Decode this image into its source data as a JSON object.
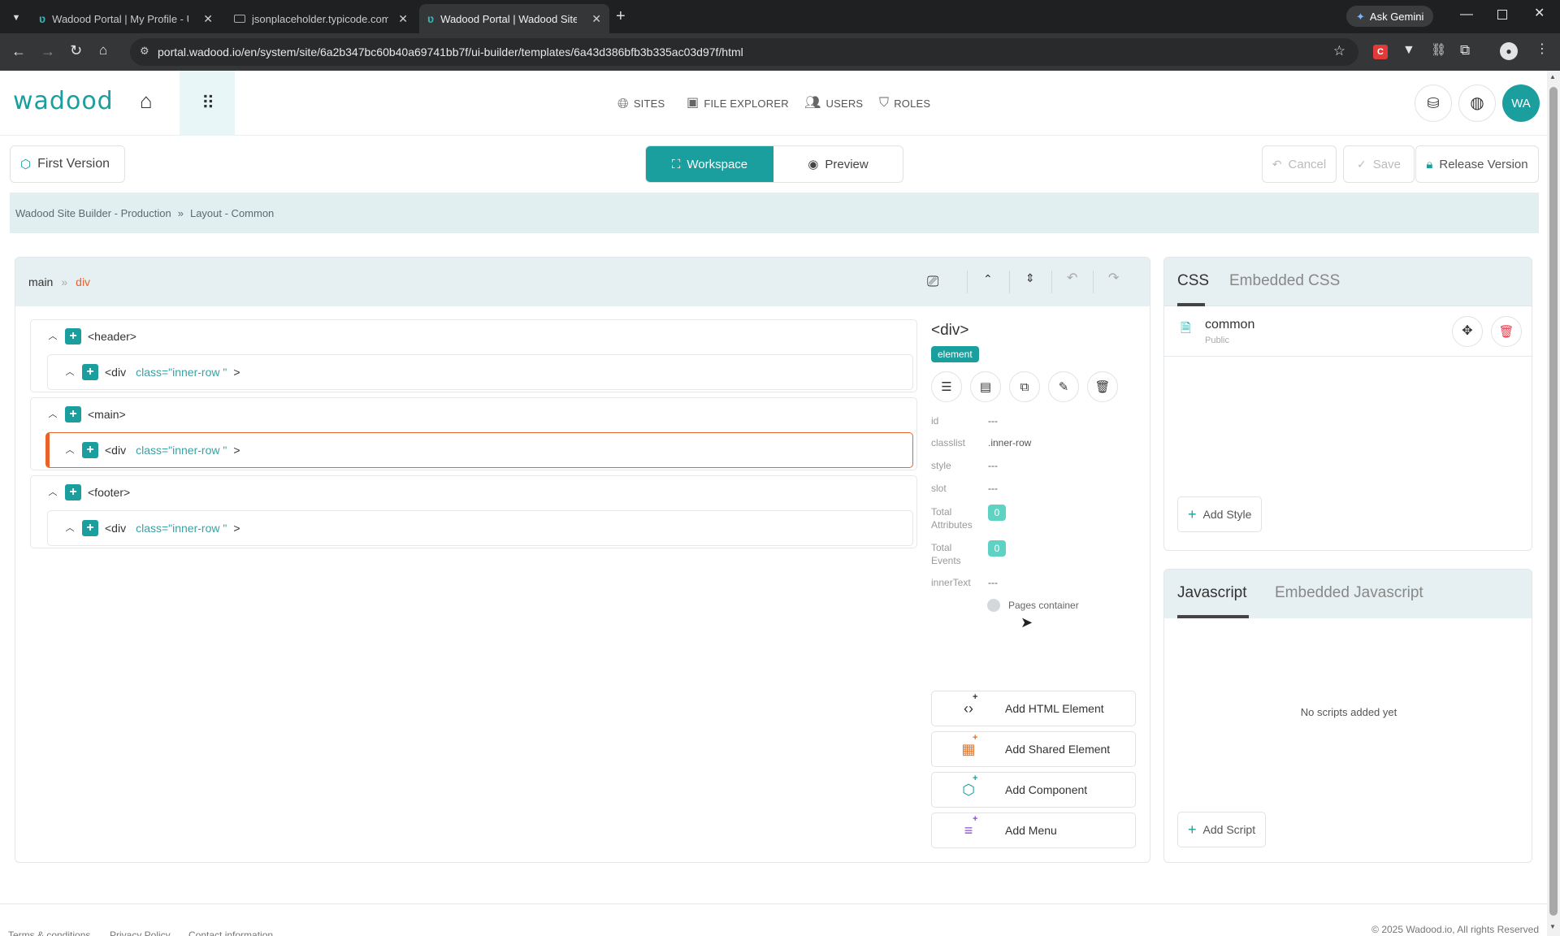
{
  "browser": {
    "tabs": [
      {
        "title": "Wadood Portal | My Profile - Us",
        "active": false
      },
      {
        "title": "jsonplaceholder.typicode.com/",
        "active": false
      },
      {
        "title": "Wadood Portal | Wadood Site B",
        "active": true
      }
    ],
    "ask_gemini": "Ask Gemini",
    "url": "portal.wadood.io/en/system/site/6a2b347bc60b40a69741bb7f/ui-builder/templates/6a43d386bfb3b335ac03d97f/html"
  },
  "header": {
    "logo": "wadood",
    "nav": [
      {
        "label": "SITES",
        "icon": "globe-icon"
      },
      {
        "label": "FILE EXPLORER",
        "icon": "images-icon"
      },
      {
        "label": "USERS",
        "icon": "users-icon"
      },
      {
        "label": "ROLES",
        "icon": "shield-icon"
      }
    ],
    "avatar": "WA"
  },
  "toolbar": {
    "version": "First Version",
    "workspace": "Workspace",
    "preview": "Preview",
    "cancel": "Cancel",
    "save": "Save",
    "release": "Release Version"
  },
  "breadcrumb": {
    "items": [
      "Wadood Site Builder - Production",
      "Layout - Common"
    ],
    "separator": "»"
  },
  "tree_panel": {
    "path_root": "main",
    "path_sep": "»",
    "path_current": "div",
    "nodes": [
      {
        "tag": "<header>",
        "child_tag": "<div",
        "child_class": "class=\"inner-row \"",
        "child_end": ">"
      },
      {
        "tag": "<main>",
        "child_tag": "<div",
        "child_class": "class=\"inner-row \"",
        "child_end": ">"
      },
      {
        "tag": "<footer>",
        "child_tag": "<div",
        "child_class": "class=\"inner-row \"",
        "child_end": ">"
      }
    ]
  },
  "properties": {
    "title": "<div>",
    "badge": "element",
    "id_label": "id",
    "id_value": "---",
    "classlist_label": "classlist",
    "classlist_value": ".inner-row",
    "style_label": "style",
    "style_value": "---",
    "slot_label": "slot",
    "slot_value": "---",
    "attrs_label_1": "Total",
    "attrs_label_2": "Attributes",
    "attrs_value": "0",
    "events_label_1": "Total",
    "events_label_2": "Events",
    "events_value": "0",
    "innertext_label": "innerText",
    "innertext_value": "---",
    "pages_container": "Pages container",
    "add_buttons": [
      "Add HTML Element",
      "Add Shared Element",
      "Add Component",
      "Add Menu"
    ]
  },
  "css_panel": {
    "tabs": [
      "CSS",
      "Embedded CSS"
    ],
    "item_name": "common",
    "item_sub": "Public",
    "add_style": "Add Style"
  },
  "js_panel": {
    "tabs": [
      "Javascript",
      "Embedded Javascript"
    ],
    "empty": "No scripts added yet",
    "add_script": "Add Script"
  },
  "footer": {
    "links": [
      "Terms & conditions",
      "Privacy Policy",
      "Contact information"
    ],
    "copyright": "© 2025 Wadood.io, All rights Reserved"
  },
  "colors": {
    "accent": "#1a9e9e",
    "selected_border": "#e8622a",
    "path_current": "#e8622a"
  }
}
